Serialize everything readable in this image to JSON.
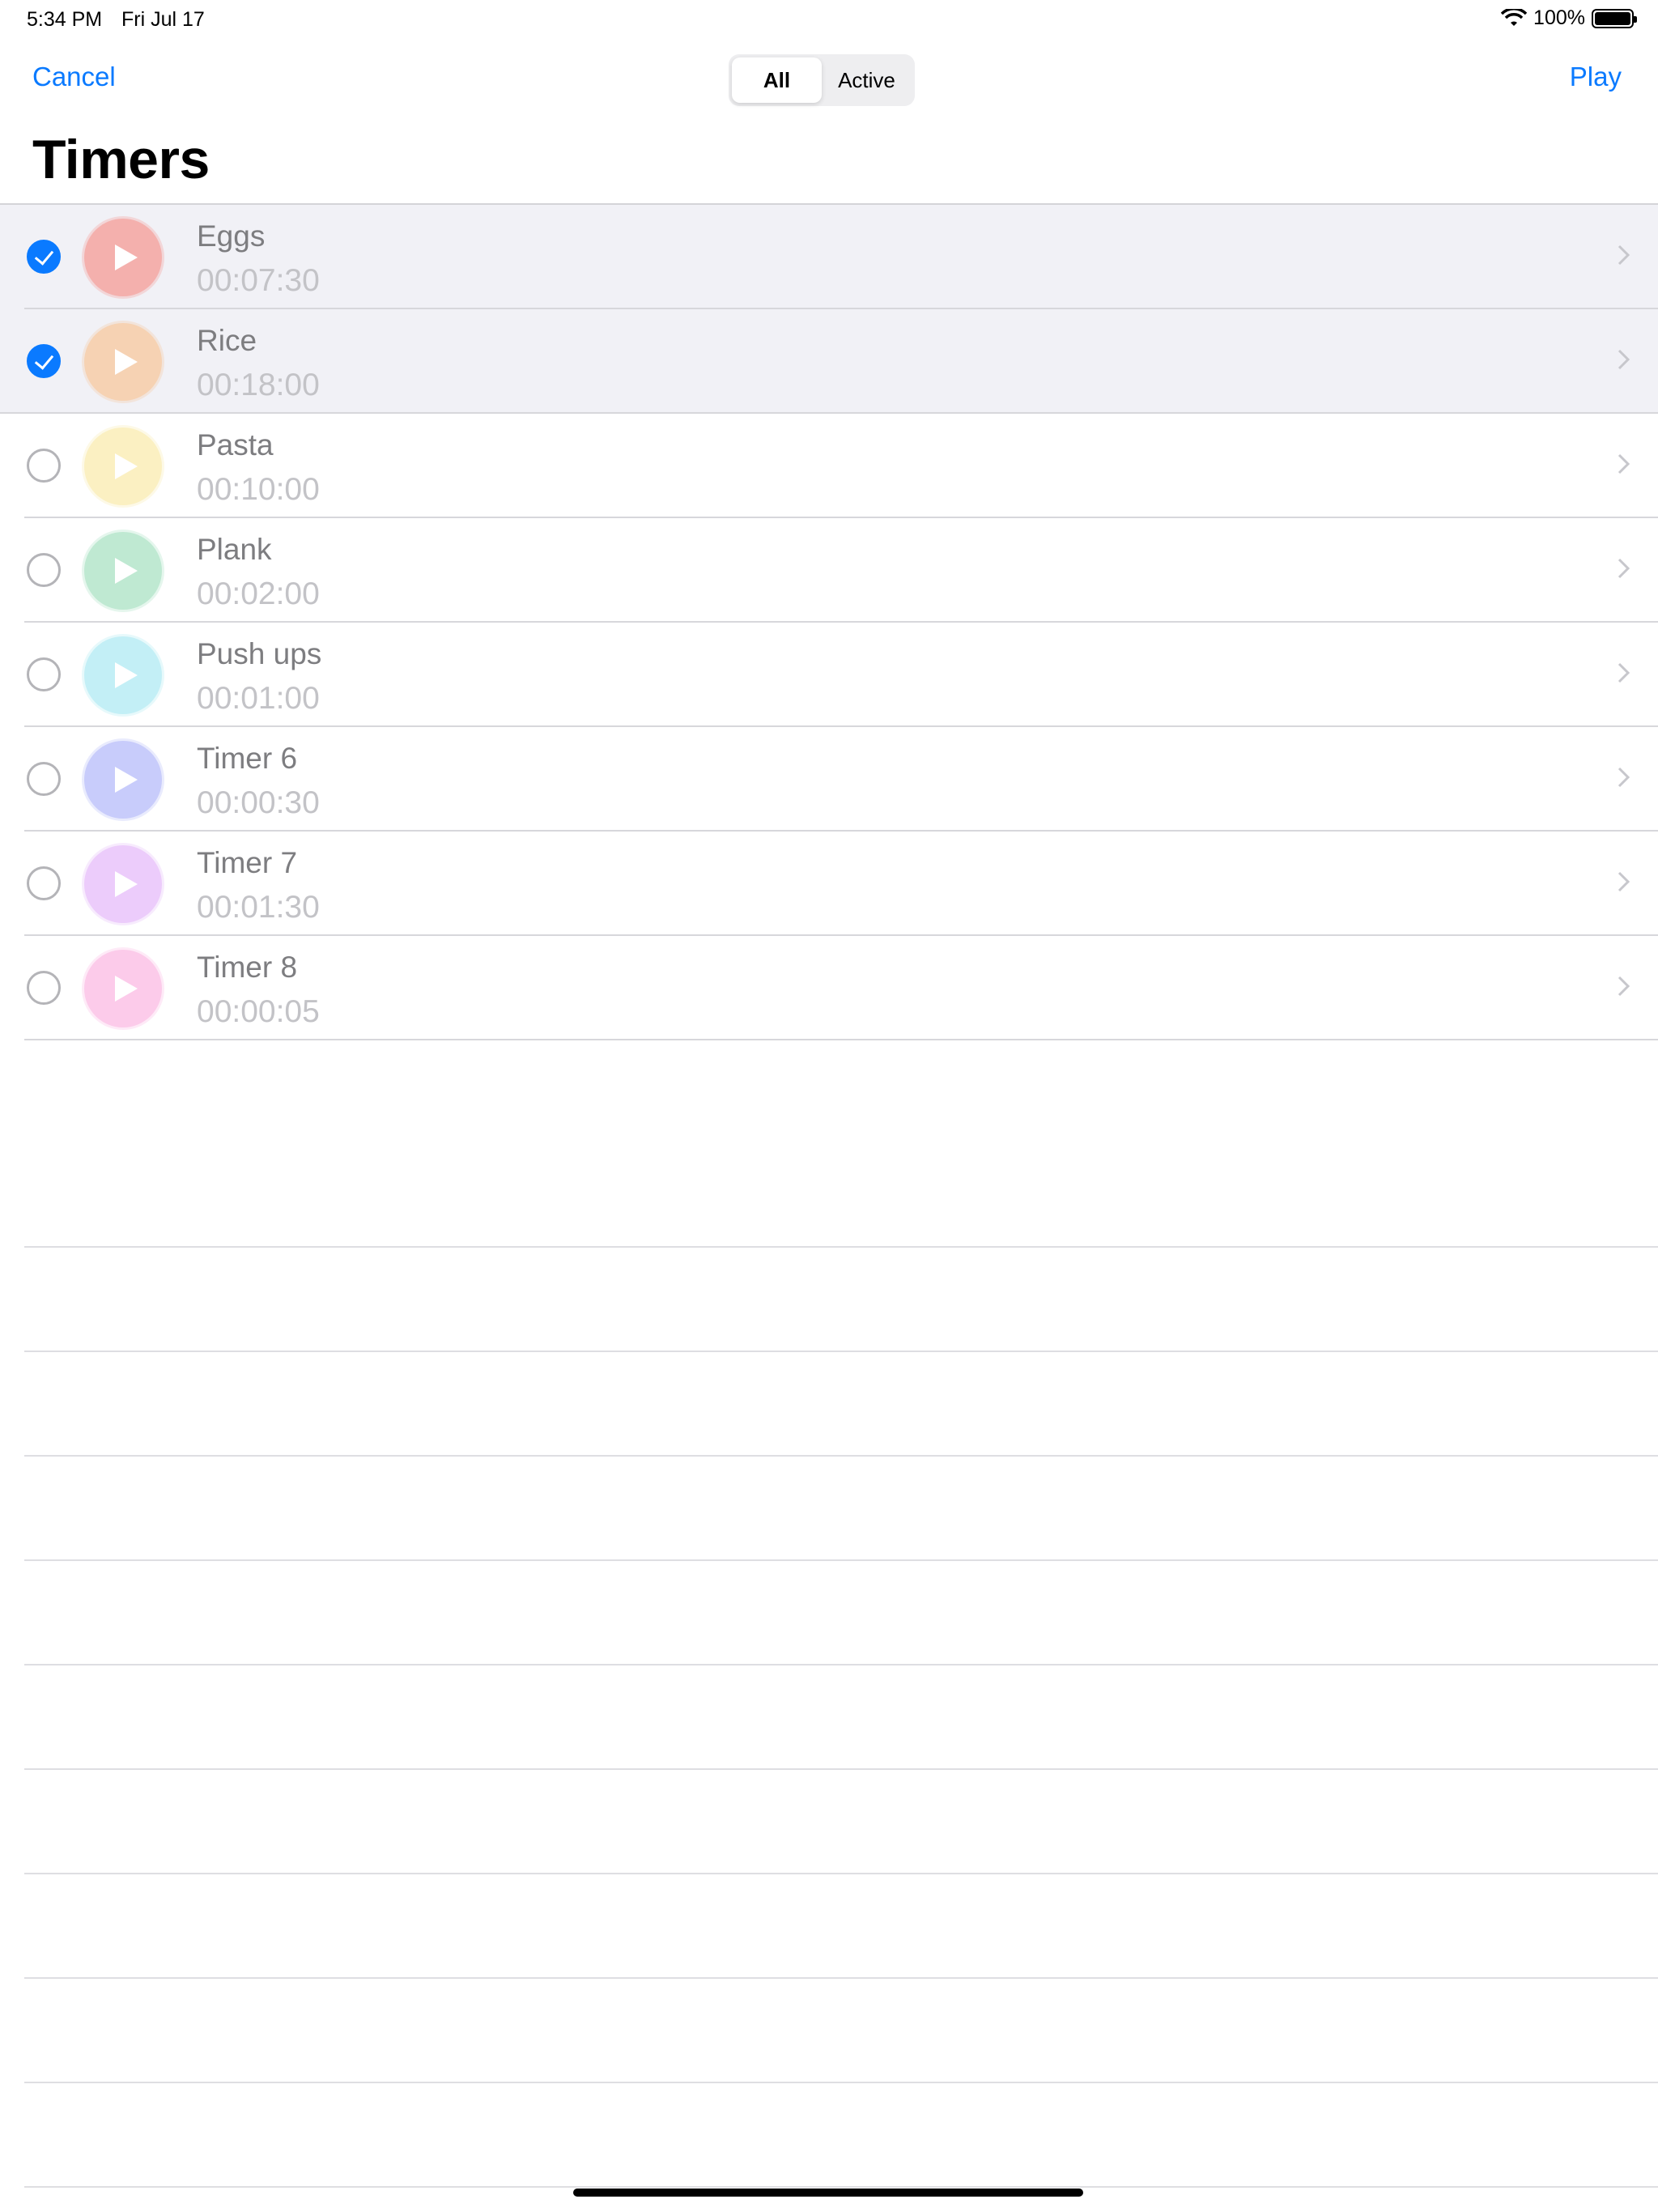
{
  "status_bar": {
    "time": "5:34 PM",
    "date": "Fri Jul 17",
    "battery": "100%"
  },
  "nav": {
    "cancel_label": "Cancel",
    "play_label": "Play",
    "segments": [
      "All",
      "Active"
    ],
    "selected_segment": "All"
  },
  "title": "Timers",
  "accent_color": "#0a7aff",
  "timers": [
    {
      "name": "Eggs",
      "duration": "00:07:30",
      "selected": true,
      "color": "#f4b0ad"
    },
    {
      "name": "Rice",
      "duration": "00:18:00",
      "selected": true,
      "color": "#f6d2b3"
    },
    {
      "name": "Pasta",
      "duration": "00:10:00",
      "selected": false,
      "color": "#fbf0c2"
    },
    {
      "name": "Plank",
      "duration": "00:02:00",
      "selected": false,
      "color": "#bfe9d2"
    },
    {
      "name": "Push ups",
      "duration": "00:01:00",
      "selected": false,
      "color": "#c3eff6"
    },
    {
      "name": "Timer 6",
      "duration": "00:00:30",
      "selected": false,
      "color": "#c8ccfb"
    },
    {
      "name": "Timer 7",
      "duration": "00:01:30",
      "selected": false,
      "color": "#ecccfb"
    },
    {
      "name": "Timer 8",
      "duration": "00:00:05",
      "selected": false,
      "color": "#fccbea"
    }
  ],
  "icons": {
    "row_leading": "play-icon",
    "row_trailing": "chevron-right-icon",
    "selection": "checkmark-icon"
  }
}
